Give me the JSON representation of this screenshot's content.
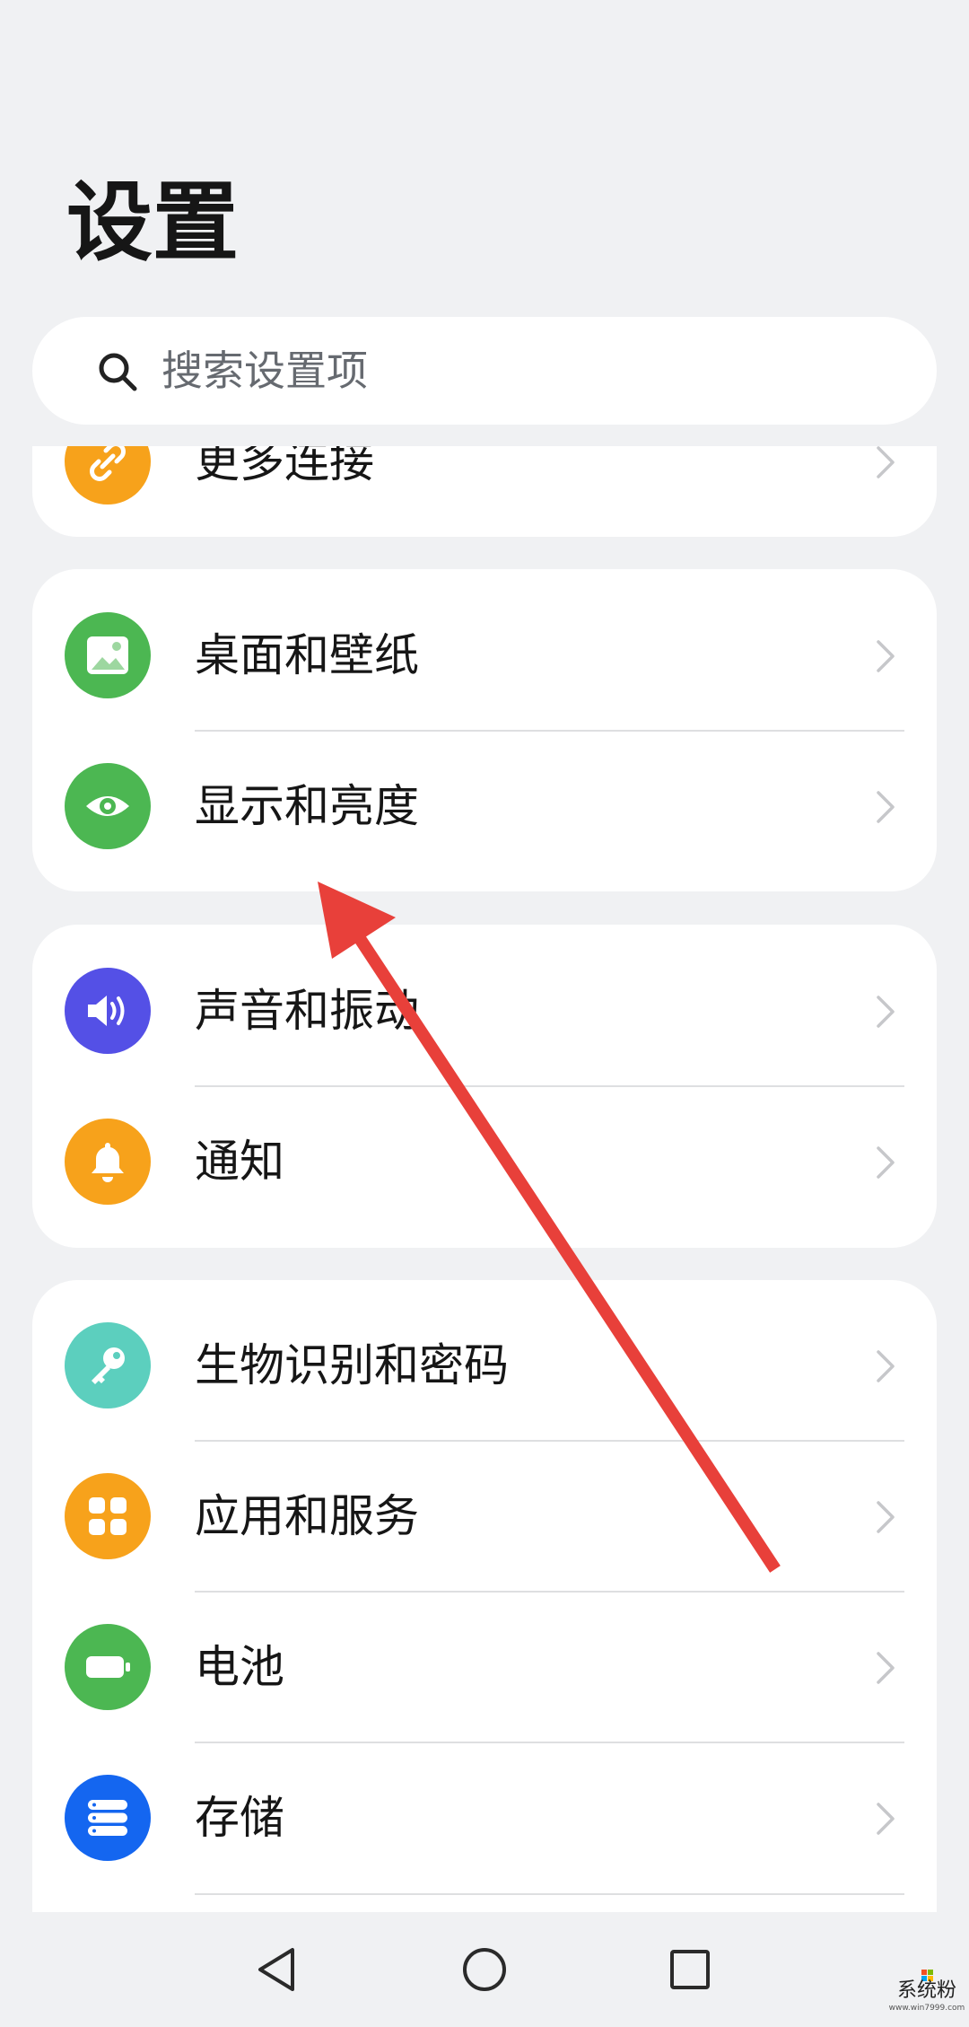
{
  "page": {
    "title": "设置"
  },
  "search": {
    "placeholder": "搜索设置项",
    "value": ""
  },
  "cards": [
    {
      "items": [
        {
          "label": "更多连接",
          "icon": "link-icon",
          "color": "#f7a21b"
        }
      ]
    },
    {
      "items": [
        {
          "label": "桌面和壁纸",
          "icon": "image-icon",
          "color": "#4cb752"
        },
        {
          "label": "显示和亮度",
          "icon": "eye-icon",
          "color": "#4cb752"
        }
      ]
    },
    {
      "items": [
        {
          "label": "声音和振动",
          "icon": "speaker-icon",
          "color": "#5450e6"
        },
        {
          "label": "通知",
          "icon": "bell-icon",
          "color": "#f7a21b"
        }
      ]
    },
    {
      "items": [
        {
          "label": "生物识别和密码",
          "icon": "key-icon",
          "color": "#5ccfbe"
        },
        {
          "label": "应用和服务",
          "icon": "apps-icon",
          "color": "#f7a21b"
        },
        {
          "label": "电池",
          "icon": "battery-icon",
          "color": "#4cb752"
        },
        {
          "label": "存储",
          "icon": "storage-icon",
          "color": "#1466f0"
        }
      ]
    }
  ],
  "annotation": {
    "arrow_color": "#e8403a"
  },
  "navigation": {
    "back_icon": "back-triangle-icon",
    "home_icon": "home-circle-icon",
    "recents_icon": "recents-square-icon"
  },
  "watermark": {
    "text": "系统粉",
    "subtext": "www.win7999.com"
  }
}
